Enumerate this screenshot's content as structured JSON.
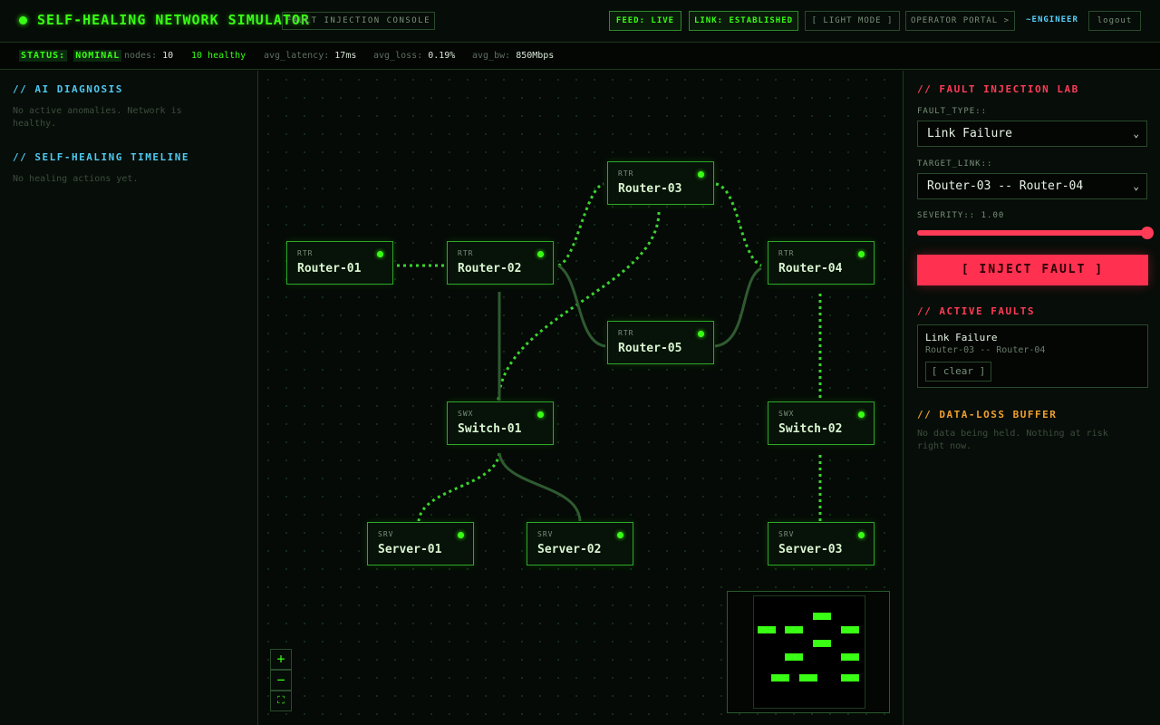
{
  "header": {
    "title": "SELF-HEALING NETWORK SIMULATOR",
    "console_tag": "FAULT INJECTION CONSOLE",
    "feed": "FEED: LIVE",
    "link": "LINK: ESTABLISHED",
    "light_mode": "[ LIGHT MODE ]",
    "operator_portal": "OPERATOR PORTAL >",
    "user": "~ENGINEER",
    "logout": "logout"
  },
  "status": {
    "label": "STATUS:",
    "value": "NOMINAL",
    "nodes_label": "nodes:",
    "nodes_value": "10",
    "healthy": "10 healthy",
    "latency_label": "avg_latency:",
    "latency_value": "17ms",
    "loss_label": "avg_loss:",
    "loss_value": "0.19%",
    "bw_label": "avg_bw:",
    "bw_value": "850Mbps"
  },
  "left": {
    "diagnosis_title": "// AI DIAGNOSIS",
    "diagnosis_text_1": "No active anomalies. Network is",
    "diagnosis_text_2": "healthy.",
    "timeline_title": "// SELF-HEALING TIMELINE",
    "timeline_text": "No healing actions yet."
  },
  "nodes": {
    "router01": {
      "type": "RTR",
      "name": "Router-01"
    },
    "router02": {
      "type": "RTR",
      "name": "Router-02"
    },
    "router03": {
      "type": "RTR",
      "name": "Router-03"
    },
    "router04": {
      "type": "RTR",
      "name": "Router-04"
    },
    "router05": {
      "type": "RTR",
      "name": "Router-05"
    },
    "switch01": {
      "type": "SWX",
      "name": "Switch-01"
    },
    "switch02": {
      "type": "SWX",
      "name": "Switch-02"
    },
    "server01": {
      "type": "SRV",
      "name": "Server-01"
    },
    "server02": {
      "type": "SRV",
      "name": "Server-02"
    },
    "server03": {
      "type": "SRV",
      "name": "Server-03"
    }
  },
  "canvas_controls": {
    "zoom_in": "+",
    "zoom_out": "−",
    "fit": "⛶"
  },
  "right": {
    "lab_title": "// FAULT INJECTION LAB",
    "fault_type_label": "FAULT_TYPE::",
    "fault_type_value": "Link Failure",
    "target_label": "TARGET_LINK::",
    "target_value": "Router-03 -- Router-04",
    "severity_label": "SEVERITY:: 1.00",
    "severity": 1.0,
    "inject_label": "[ INJECT FAULT ]",
    "active_title": "// ACTIVE FAULTS",
    "active_fault_type": "Link Failure",
    "active_fault_target": "Router-03 -- Router-04",
    "clear_label": "[ clear ]",
    "buffer_title": "// DATA-LOSS BUFFER",
    "buffer_text_1": "No data being held. Nothing at risk",
    "buffer_text_2": "right now."
  },
  "colors": {
    "accent": "#39ff14",
    "danger": "#ff3b58",
    "info": "#4fc8f0",
    "warning": "#f0a030"
  }
}
